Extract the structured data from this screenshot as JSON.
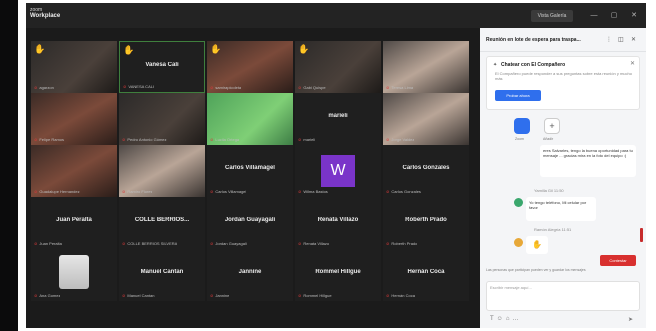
{
  "app": {
    "brand_top": "zoom",
    "brand_name": "Workplace",
    "view_label": "Vista Galería",
    "controls": [
      "—",
      "▢",
      "✕"
    ]
  },
  "tiles": [
    {
      "label": "",
      "foot": "agarzon",
      "hand": true,
      "style": "video-dark"
    },
    {
      "label": "Vanesa Cali",
      "foot": "VANESA CALI",
      "hand": true,
      "style": "active"
    },
    {
      "label": "",
      "foot": "samirapicoleta",
      "hand": true,
      "style": "video-warm"
    },
    {
      "label": "",
      "foot": "Gabi Quispe",
      "hand": true,
      "style": "video-dark"
    },
    {
      "label": "",
      "foot": "Teresa Lima",
      "hand": false,
      "style": "video-light"
    },
    {
      "label": "",
      "foot": "Felipe Ramos",
      "hand": false,
      "style": "video-warm"
    },
    {
      "label": "",
      "foot": "Pedro Antonio Gómez",
      "hand": false,
      "style": "video-dark"
    },
    {
      "label": "",
      "foot": "Lucila Ortega",
      "hand": false,
      "style": "video-green"
    },
    {
      "label": "marieli",
      "foot": "marieli",
      "hand": false,
      "style": ""
    },
    {
      "label": "",
      "foot": "Jorge Valdez",
      "hand": false,
      "style": "video-light"
    },
    {
      "label": "",
      "foot": "Guadalupe Hernandez",
      "hand": false,
      "style": "video-warm"
    },
    {
      "label": "",
      "foot": "Ramiro Flores",
      "hand": false,
      "style": "video-light"
    },
    {
      "label": "Carlos Villamagel",
      "foot": "Carlos Villamagel",
      "hand": false,
      "style": ""
    },
    {
      "label": "",
      "foot": "Wilma Bastos",
      "hand": false,
      "style": "avatar-w",
      "avatar": "W"
    },
    {
      "label": "Carlos Gonzales",
      "foot": "Carlos Gonzales",
      "hand": false,
      "style": ""
    },
    {
      "label": "Juan Peralta",
      "foot": "Juan Peralta",
      "hand": false,
      "style": ""
    },
    {
      "label": "COLLE BERRIOS...",
      "foot": "COLLE BERRIOS SILVERA",
      "hand": false,
      "style": ""
    },
    {
      "label": "Jordan Guayagali",
      "foot": "Jordan Guayagali",
      "hand": false,
      "style": ""
    },
    {
      "label": "Renata Villazo",
      "foot": "Renata Villazo",
      "hand": false,
      "style": ""
    },
    {
      "label": "Roberth Prado",
      "foot": "Roberth Prado",
      "hand": false,
      "style": ""
    },
    {
      "label": "",
      "foot": "Ana Gomez",
      "hand": false,
      "style": "avatar-photo"
    },
    {
      "label": "Manuel Cantan",
      "foot": "Manuel Cantan",
      "hand": false,
      "style": ""
    },
    {
      "label": "Jannine",
      "foot": "Jannine",
      "hand": false,
      "style": ""
    },
    {
      "label": "Rommel Hillgue",
      "foot": "Rommel Hillgue",
      "hand": false,
      "style": ""
    },
    {
      "label": "Hernán Coca",
      "foot": "Hernán Coca",
      "hand": false,
      "style": ""
    }
  ],
  "chat": {
    "title": "Reunión en lote de espera para traspa...",
    "controls": [
      "⋮",
      "◫",
      "✕"
    ],
    "promo_title": "Chatear con El Compañero",
    "promo_text": "El Compañero puede responder a sus preguntas sobre esta reunión y mucho más",
    "promo_button": "Probar ahora",
    "app_icons": [
      {
        "label": "Zoom",
        "color": "#2f6fed"
      },
      {
        "label": "Añadir",
        "color": "#ffffff"
      }
    ],
    "messages": [
      {
        "sender": "",
        "text": "eres Salvarles, tengo la buena oportunidad para tu mensaje ... gracias mira en la foto del equipo :)"
      },
      {
        "sender": "Yamilla Gil 11:50",
        "text": ""
      },
      {
        "sender": "",
        "text": "Yo tengo teléfono, Mi celular por favor"
      },
      {
        "sender": "Ramón Alegría 11:51",
        "text": ""
      }
    ],
    "reply_label": "Contestar",
    "notice": "Las personas que participan pueden ver y guardar los mensajes",
    "input_placeholder": "Escribir mensaje aquí...",
    "tools": [
      "T",
      "☺",
      "⌂",
      "…"
    ],
    "send_icon": "➤"
  }
}
